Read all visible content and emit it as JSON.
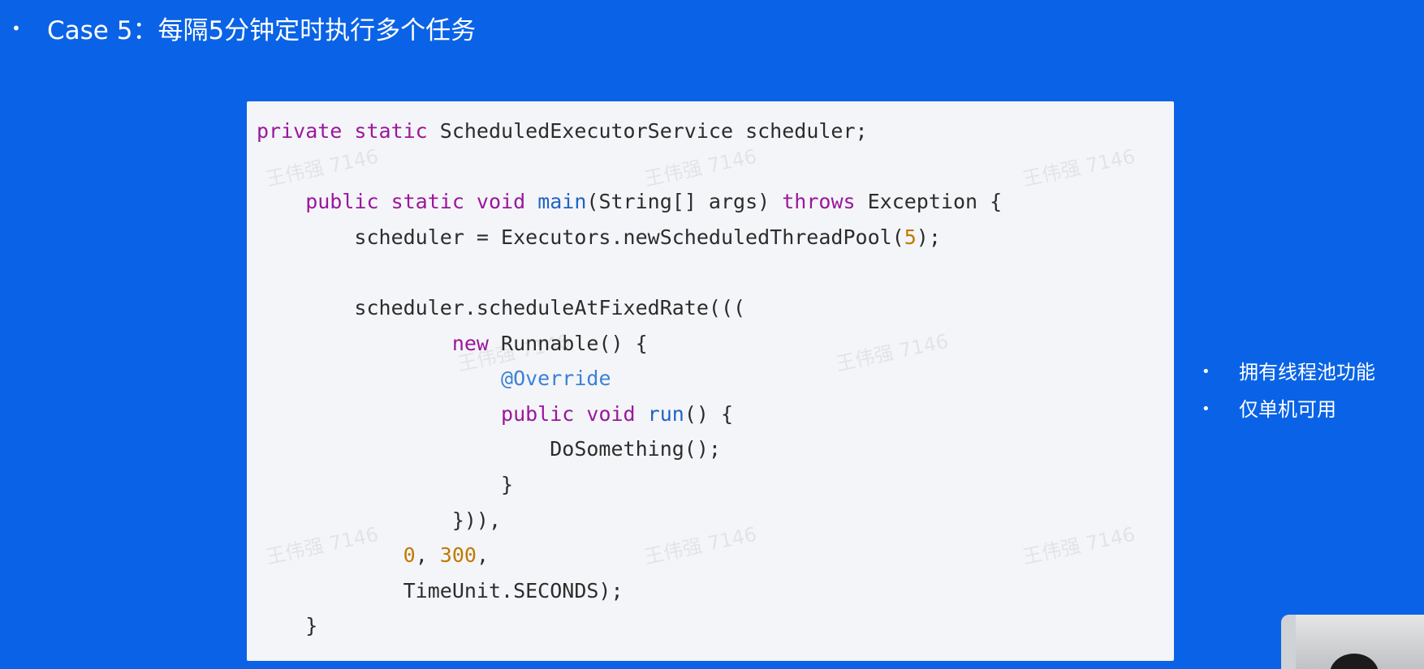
{
  "slide": {
    "title": "Case 5：每隔5分钟定时执行多个任务",
    "bullet_glyph": "•"
  },
  "code": {
    "lines": [
      [
        {
          "t": "private static ",
          "c": "kw"
        },
        {
          "t": "ScheduledExecutorService scheduler;",
          "c": "plain"
        }
      ],
      [],
      [
        {
          "t": "    public static void ",
          "c": "kw"
        },
        {
          "t": "main",
          "c": "fn"
        },
        {
          "t": "(String[] args) ",
          "c": "plain"
        },
        {
          "t": "throws",
          "c": "kw"
        },
        {
          "t": " Exception {",
          "c": "plain"
        }
      ],
      [
        {
          "t": "        scheduler = Executors.newScheduledThreadPool(",
          "c": "plain"
        },
        {
          "t": "5",
          "c": "num"
        },
        {
          "t": ");",
          "c": "plain"
        }
      ],
      [],
      [
        {
          "t": "        scheduler.scheduleAtFixedRate(((",
          "c": "plain"
        }
      ],
      [
        {
          "t": "                ",
          "c": "plain"
        },
        {
          "t": "new",
          "c": "kw"
        },
        {
          "t": " Runnable() {",
          "c": "plain"
        }
      ],
      [
        {
          "t": "                    ",
          "c": "plain"
        },
        {
          "t": "@Override",
          "c": "ann"
        }
      ],
      [
        {
          "t": "                    ",
          "c": "plain"
        },
        {
          "t": "public void ",
          "c": "kw"
        },
        {
          "t": "run",
          "c": "fn"
        },
        {
          "t": "() {",
          "c": "plain"
        }
      ],
      [
        {
          "t": "                        DoSomething();",
          "c": "plain"
        }
      ],
      [
        {
          "t": "                    }",
          "c": "plain"
        }
      ],
      [
        {
          "t": "                })),",
          "c": "plain"
        }
      ],
      [
        {
          "t": "            ",
          "c": "plain"
        },
        {
          "t": "0",
          "c": "num"
        },
        {
          "t": ", ",
          "c": "plain"
        },
        {
          "t": "300",
          "c": "num"
        },
        {
          "t": ",",
          "c": "plain"
        }
      ],
      [
        {
          "t": "            TimeUnit.SECONDS);",
          "c": "plain"
        }
      ],
      [
        {
          "t": "    }",
          "c": "plain"
        }
      ]
    ],
    "watermark": "王伟强 7146"
  },
  "side": {
    "bullets": [
      "拥有线程池功能",
      "仅单机可用"
    ]
  },
  "colors": {
    "background": "#0a63e6",
    "code_bg": "#f4f5f8",
    "keyword": "#9a179c",
    "function": "#1f63c6",
    "number": "#c07a00",
    "annotation": "#3c81d6"
  }
}
